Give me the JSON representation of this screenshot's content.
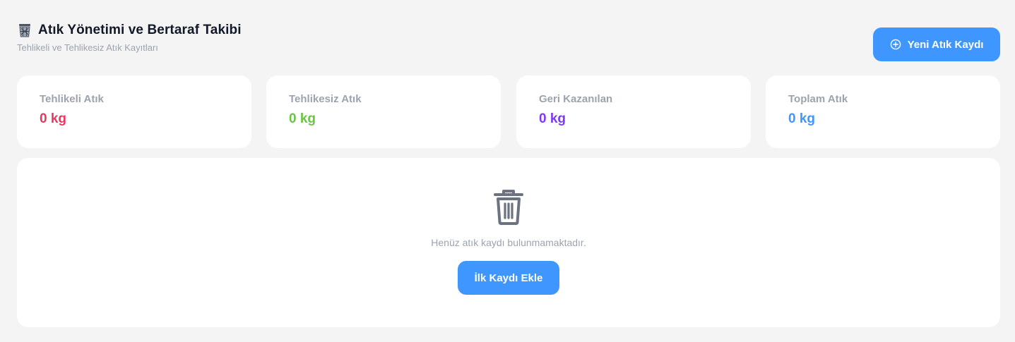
{
  "header": {
    "icon": "wastebasket-icon",
    "title": "Atık Yönetimi ve Bertaraf Takibi",
    "subtitle": "Tehlikeli ve Tehlikesiz Atık Kayıtları"
  },
  "toolbar": {
    "new_record_icon": "plus-circle-icon",
    "new_record_label": "Yeni Atık Kaydı"
  },
  "stats": [
    {
      "label": "Tehlikeli Atık",
      "value": "0 kg",
      "color": "#e8385f"
    },
    {
      "label": "Tehlikesiz Atık",
      "value": "0 kg",
      "color": "#6cc24a"
    },
    {
      "label": "Geri Kazanılan",
      "value": "0 kg",
      "color": "#7e3af2"
    },
    {
      "label": "Toplam Atık",
      "value": "0 kg",
      "color": "#4096ff"
    }
  ],
  "empty_state": {
    "icon": "trash-icon",
    "message": "Henüz atık kaydı bulunmamaktadır.",
    "button_label": "İlk Kaydı Ekle"
  },
  "colors": {
    "accent": "#4096ff",
    "background": "#f4f4f5"
  }
}
